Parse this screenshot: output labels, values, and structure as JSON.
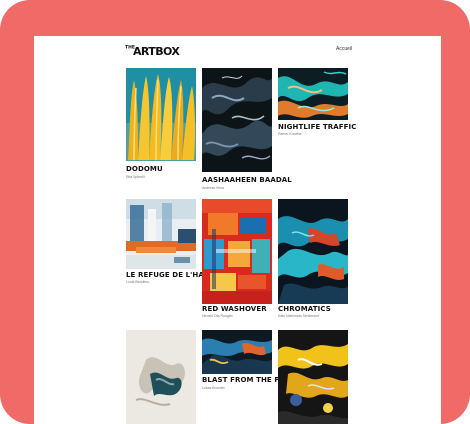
{
  "brand": {
    "prefix": "THE",
    "name": "ARTBOX"
  },
  "nav": {
    "label": "Accueil"
  },
  "artworks": [
    {
      "title": "DODOMU",
      "artist": "Rita Spinelli"
    },
    {
      "title": "AASHAAHEEN BAADAL",
      "artist": "Andreas Vesa"
    },
    {
      "title": "NIGHTLIFE TRAFFIC",
      "artist": "Rainer Krauthe"
    },
    {
      "title": "LE REFUGE DE L'HAVRE",
      "artist": "Louis Beaulieu"
    },
    {
      "title": "RED WASHOVER",
      "artist": "Hiroshi Ota Rougier"
    },
    {
      "title": "CHROMATICS",
      "artist": "Kato Nishimoto Tenderdorf"
    },
    {
      "title": "",
      "artist": ""
    },
    {
      "title": "BLAST FROM THE PAST",
      "artist": "Lukas Brunner"
    },
    {
      "title": "",
      "artist": ""
    }
  ]
}
